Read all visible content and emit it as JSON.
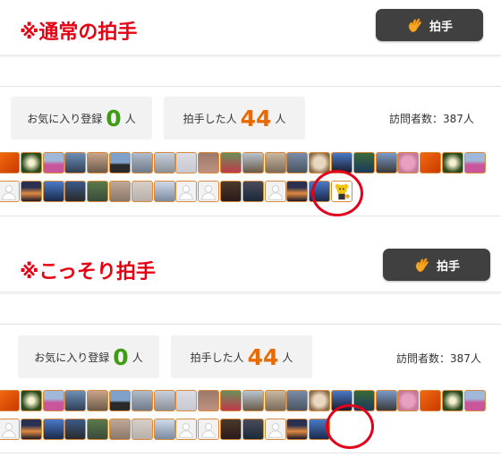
{
  "section1": {
    "title": "※通常の拍手",
    "clap_button": "拍手",
    "fav_label": "お気に入り登録",
    "fav_count": "0",
    "fav_unit": "人",
    "clap_label": "拍手した人",
    "clap_count": "44",
    "clap_unit": "人",
    "visitors": "訪問者数：387人"
  },
  "section2": {
    "title": "※こっそり拍手",
    "clap_button": "拍手",
    "fav_label": "お気に入り登録",
    "fav_count": "0",
    "fav_unit": "人",
    "clap_label": "拍手した人",
    "clap_count": "44",
    "clap_unit": "人",
    "visitors": "訪問者数：387人"
  },
  "colors": {
    "accent_red": "#e60012",
    "button_bg": "#404040",
    "fav_green": "#3f9b12",
    "clap_orange": "#ea6a00",
    "thumb_border": "#d98a3c",
    "circle_red": "#e3001b"
  },
  "icons": {
    "clap": "waving-hand-icon",
    "mascot": "yellow-bear-mascot-icon",
    "default_avatar": "default-user-avatar-icon"
  }
}
